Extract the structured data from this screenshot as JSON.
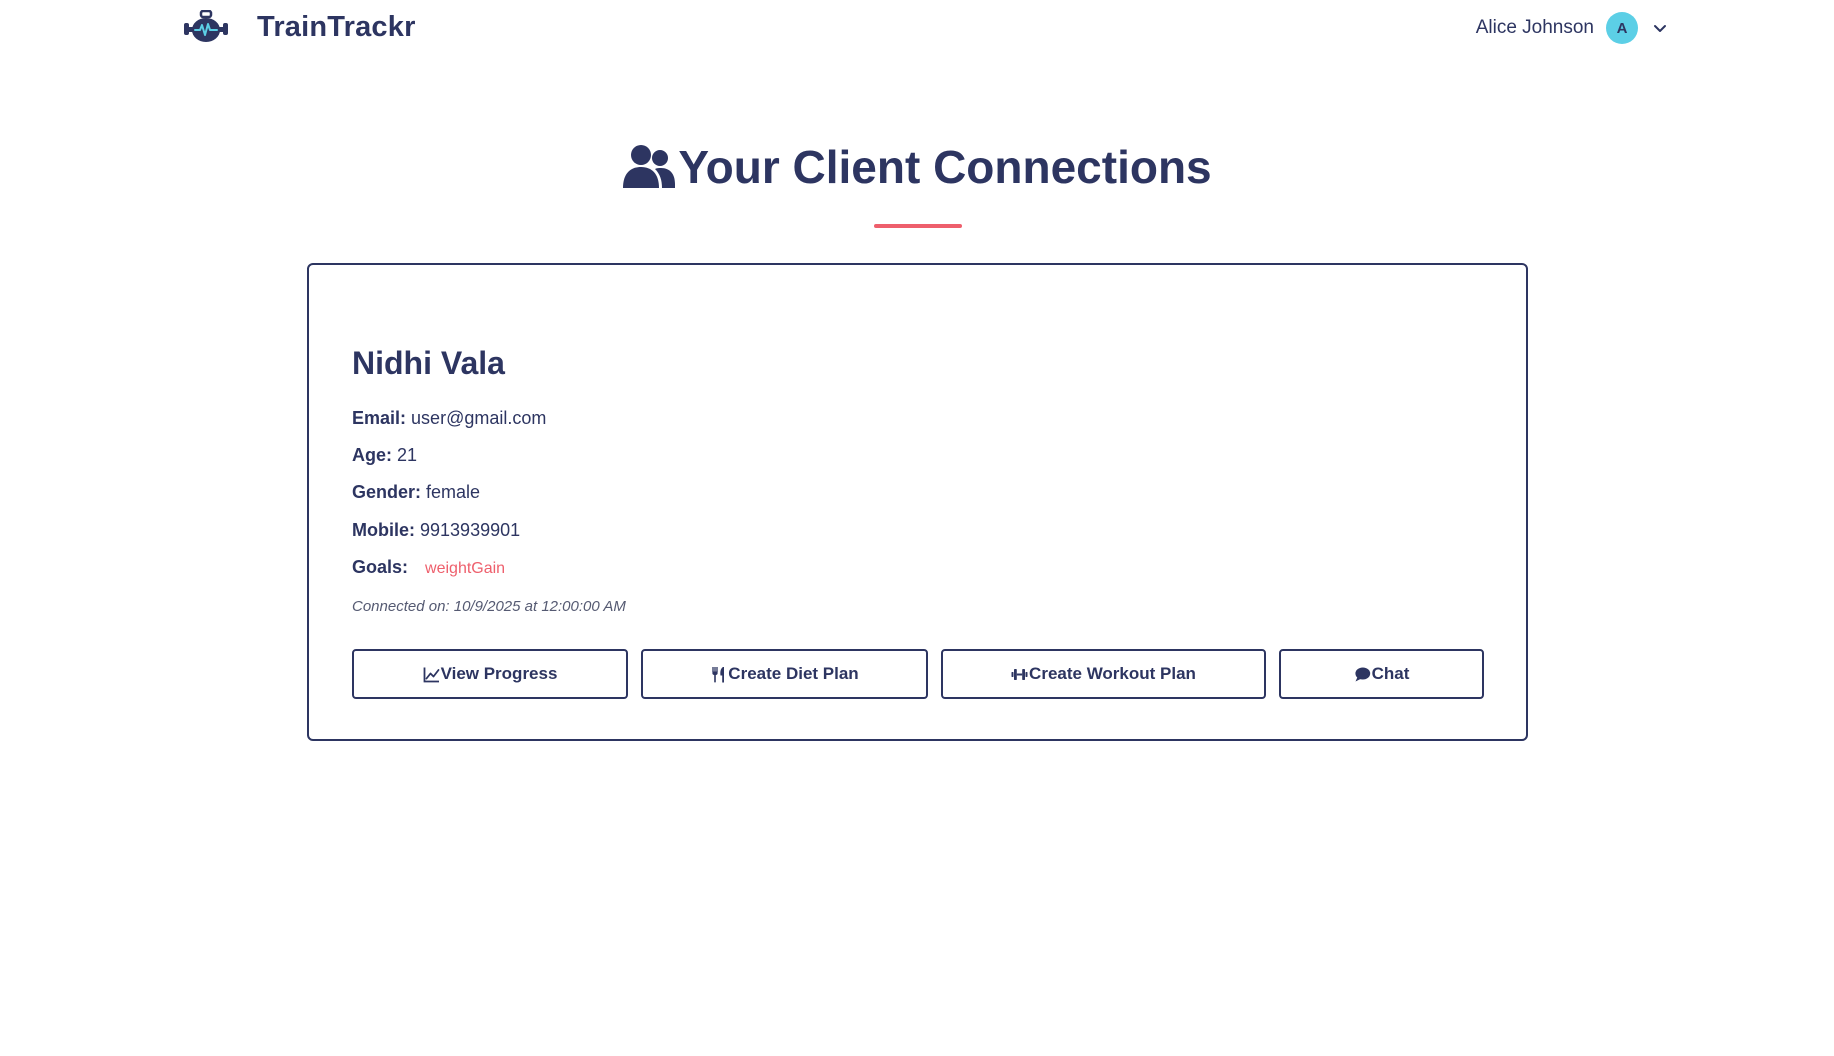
{
  "header": {
    "brand_name": "TrainTrackr",
    "logo_icon": "kettlebell-heartbeat-icon",
    "user_name": "Alice Johnson",
    "avatar_initial": "A",
    "avatar_color": "#5ccfe6",
    "dropdown_icon": "chevron-down-icon"
  },
  "page": {
    "title": "Your Client Connections",
    "title_icon": "users-icon",
    "accent_color": "#ee5f6c",
    "primary_color": "#2d3561"
  },
  "clients": [
    {
      "name": "Nidhi Vala",
      "email_label": "Email:",
      "email": "user@gmail.com",
      "age_label": "Age:",
      "age": "21",
      "gender_label": "Gender:",
      "gender": "female",
      "mobile_label": "Mobile:",
      "mobile": "9913939901",
      "goals_label": "Goals:",
      "goals": [
        "weightGain"
      ],
      "connected_on": "Connected on: 10/9/2025 at 12:00:00 AM",
      "actions": {
        "view_progress": "View Progress",
        "create_diet_plan": "Create Diet Plan",
        "create_workout_plan": "Create Workout Plan",
        "chat": "Chat"
      }
    }
  ]
}
